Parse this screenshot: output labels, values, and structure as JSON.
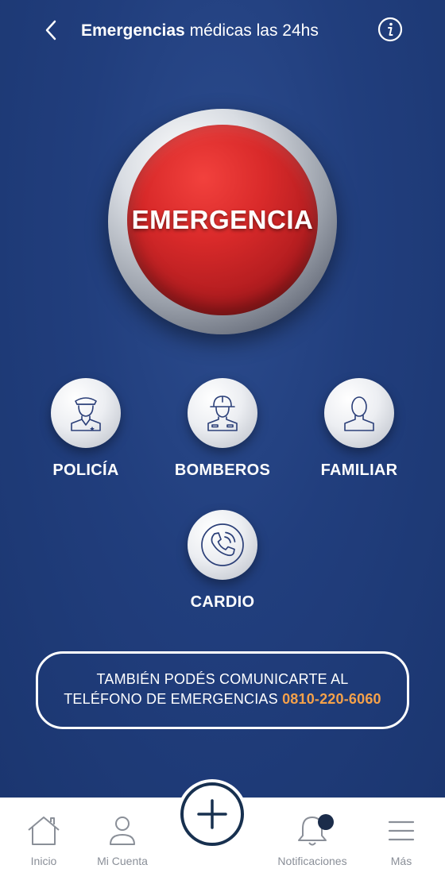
{
  "header": {
    "title_bold": "Emergencias",
    "title_rest": " médicas las 24hs",
    "back_icon": "chevron-left-icon",
    "info_icon": "info-icon"
  },
  "emergency": {
    "label": "EMERGENCIA",
    "color": "#d92a2a"
  },
  "services": [
    {
      "label": "POLICÍA",
      "icon": "police-icon"
    },
    {
      "label": "BOMBEROS",
      "icon": "firefighter-icon"
    },
    {
      "label": "FAMILIAR",
      "icon": "person-icon"
    },
    {
      "label": "CARDIO",
      "icon": "phone-call-icon"
    }
  ],
  "info": {
    "line1": "TAMBIÉN PODÉS COMUNICARTE AL",
    "line2": "TELÉFONO DE EMERGENCIAS ",
    "phone": "0810-220-6060",
    "phone_color": "#f5a14a"
  },
  "tabbar": {
    "items": [
      {
        "label": "Inicio",
        "icon": "home-icon"
      },
      {
        "label": "Mi Cuenta",
        "icon": "user-icon"
      },
      {
        "label": "Notificaciones",
        "icon": "bell-icon"
      },
      {
        "label": "Más",
        "icon": "menu-icon"
      }
    ],
    "fab_icon": "plus-icon"
  },
  "colors": {
    "background": "#213e7d",
    "accent": "#f5a14a",
    "dark": "#17304f"
  }
}
